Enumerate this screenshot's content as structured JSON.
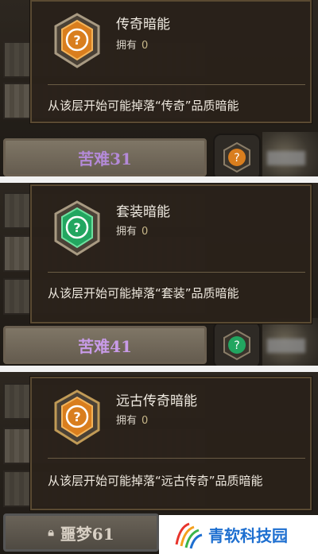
{
  "panels": [
    {
      "tooltip": {
        "title": "传奇暗能",
        "owned_label": "拥有",
        "owned_count": "0",
        "description": "从该层开始可能掉落“传奇”品质暗能",
        "gem_color": "#d97e1e"
      },
      "bar_label": "苦难31",
      "bar_color": "#b48ad8"
    },
    {
      "tooltip": {
        "title": "套装暗能",
        "owned_label": "拥有",
        "owned_count": "0",
        "description": "从该层开始可能掉落“套装”品质暗能",
        "gem_color": "#22a660"
      },
      "bar_label": "苦难41",
      "bar_color": "#c89be8"
    },
    {
      "tooltip": {
        "title": "远古传奇暗能",
        "owned_label": "拥有",
        "owned_count": "0",
        "description": "从该层开始可能掉落“远古传奇”品质暗能",
        "gem_color": "#d97e1e"
      },
      "bar_label": "噩梦61",
      "bar_color": "#d8d0c4"
    }
  ],
  "watermark": {
    "text": "青软科技园"
  }
}
